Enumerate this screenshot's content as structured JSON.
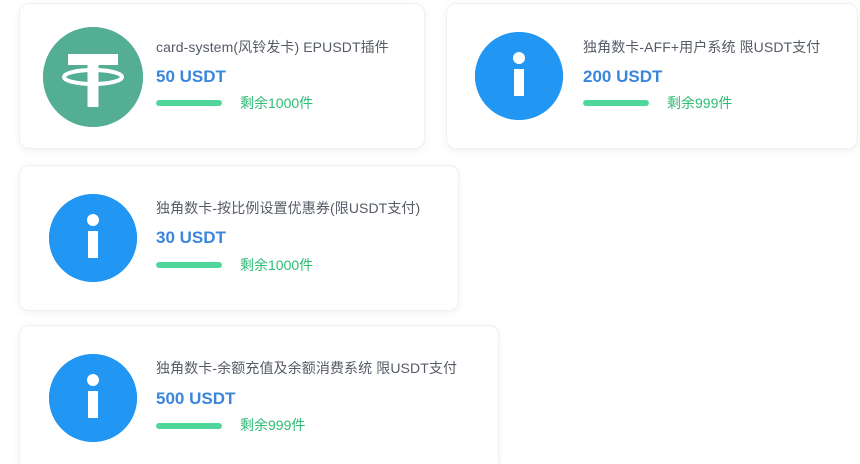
{
  "colors": {
    "tether_green": "#53ae94",
    "info_blue": "#2196f3",
    "price_blue": "#3a86dc",
    "stock_green": "#2cbc74",
    "bar_green": "#4fd69a"
  },
  "products": [
    {
      "icon": "tether-usdt-icon",
      "title": "card-system(风铃发卡) EPUSDT插件",
      "price": "50 USDT",
      "stock": "剩余1000件",
      "stock_level": 1.0
    },
    {
      "icon": "info-icon",
      "title": "独角数卡-AFF+用户系统 限USDT支付",
      "price": "200 USDT",
      "stock": "剩余999件",
      "stock_level": 1.0
    },
    {
      "icon": "info-icon",
      "title": "独角数卡-按比例设置优惠券(限USDT支付)",
      "price": "30 USDT",
      "stock": "剩余1000件",
      "stock_level": 1.0
    },
    {
      "icon": "info-icon",
      "title": "独角数卡-余额充值及余额消费系统 限USDT支付",
      "price": "500 USDT",
      "stock": "剩余999件",
      "stock_level": 1.0
    }
  ]
}
